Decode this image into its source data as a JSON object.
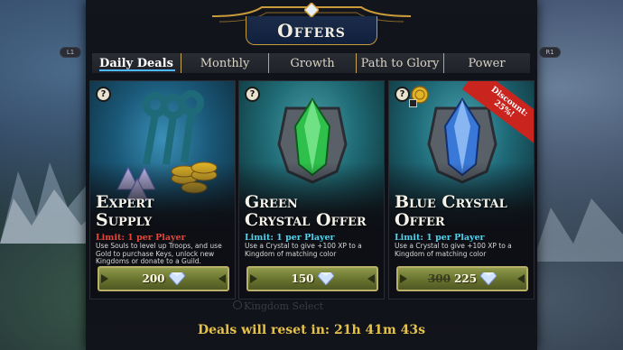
{
  "header": {
    "title": "Offers"
  },
  "controls": {
    "left_shoulder": "L1",
    "right_shoulder": "R1"
  },
  "tabs": [
    {
      "label": "Daily Deals",
      "active": true
    },
    {
      "label": "Monthly",
      "active": false
    },
    {
      "label": "Growth",
      "active": false
    },
    {
      "label": "Path to Glory",
      "active": false
    },
    {
      "label": "Power",
      "active": false
    }
  ],
  "cards": [
    {
      "title_line1": "Expert",
      "title_line2": "Supply",
      "limit": "Limit: 1 per Player",
      "limit_color": "#e5463a",
      "description": "Use Souls to level up Troops, and use Gold to purchase Keys, unlock new Kingdoms or donate to a Guild.",
      "price": "200",
      "help": "?",
      "art_icon": "keys-souls-gold-icon"
    },
    {
      "title_line1": "Green",
      "title_line2": "Crystal Offer",
      "limit": "Limit: 1 per Player",
      "limit_color": "#4fd3ef",
      "description": "Use a Crystal to give +100 XP to a Kingdom of matching color",
      "price": "150",
      "help": "?",
      "art_icon": "green-crystal-icon"
    },
    {
      "title_line1": "Blue Crystal",
      "title_line2": "Offer",
      "limit": "Limit: 1 per Player",
      "limit_color": "#4fd3ef",
      "description": "Use a Crystal to give +100 XP to a Kingdom of matching color",
      "price_old": "300",
      "price": "225",
      "help": "?",
      "discount_line1": "Discount:",
      "discount_line2": "25%!",
      "art_icon": "blue-crystal-icon"
    }
  ],
  "background_hint": "Kingdom Select",
  "footer": {
    "reset_text": "Deals will reset in: 21h 41m 43s"
  },
  "colors": {
    "accent_gold": "#e6c24a",
    "tab_highlight": "#4db8ff",
    "price_bar": "#6a7530"
  }
}
